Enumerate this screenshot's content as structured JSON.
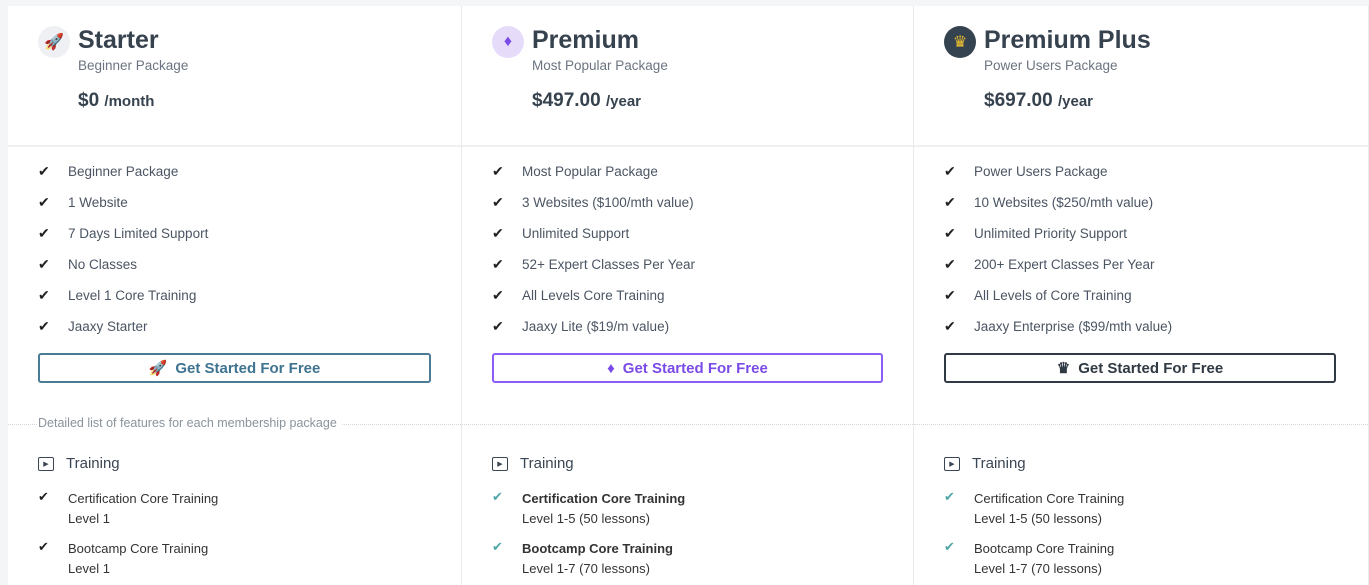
{
  "plans": [
    {
      "icon": "rocket-icon",
      "glyph": "🚀",
      "title": "Starter",
      "subtitle": "Beginner Package",
      "price": "$0",
      "period": "/month",
      "features": [
        "Beginner Package",
        "1 Website",
        "7 Days Limited Support",
        "No Classes",
        "Level 1 Core Training",
        "Jaaxy Starter"
      ],
      "button": "Get Started For Free",
      "button_color": "#3f7490",
      "training": [
        {
          "name": "Certification Core Training",
          "detail": "Level 1"
        },
        {
          "name": "Bootcamp Core Training",
          "detail": "Level 1"
        }
      ]
    },
    {
      "icon": "diamond-icon",
      "glyph": "♦",
      "title": "Premium",
      "subtitle": "Most Popular Package",
      "price": "$497.00",
      "period": "/year",
      "features": [
        "Most Popular Package",
        "3 Websites ($100/mth value)",
        "Unlimited Support",
        "52+ Expert Classes Per Year",
        "All Levels Core Training",
        "Jaaxy Lite ($19/m value)"
      ],
      "button": "Get Started For Free",
      "button_color": "#7b4be8",
      "training": [
        {
          "name": "Certification Core Training",
          "detail": "Level 1-5 (50 lessons)"
        },
        {
          "name": "Bootcamp Core Training",
          "detail": "Level 1-7 (70 lessons)"
        }
      ]
    },
    {
      "icon": "crown-icon",
      "glyph": "♛",
      "title": "Premium Plus",
      "subtitle": "Power Users Package",
      "price": "$697.00",
      "period": "/year",
      "features": [
        "Power Users Package",
        "10 Websites ($250/mth value)",
        "Unlimited Priority Support",
        "200+ Expert Classes Per Year",
        "All Levels of Core Training",
        "Jaaxy Enterprise ($99/mth value)"
      ],
      "button": "Get Started For Free",
      "button_color": "#2f3a44",
      "training": [
        {
          "name": "Certification Core Training",
          "detail": "Level 1-5 (50 lessons)"
        },
        {
          "name": "Bootcamp Core Training",
          "detail": "Level 1-7 (70 lessons)"
        }
      ]
    }
  ],
  "features_note": "Detailed list of features for each membership package",
  "section_title": "Training"
}
